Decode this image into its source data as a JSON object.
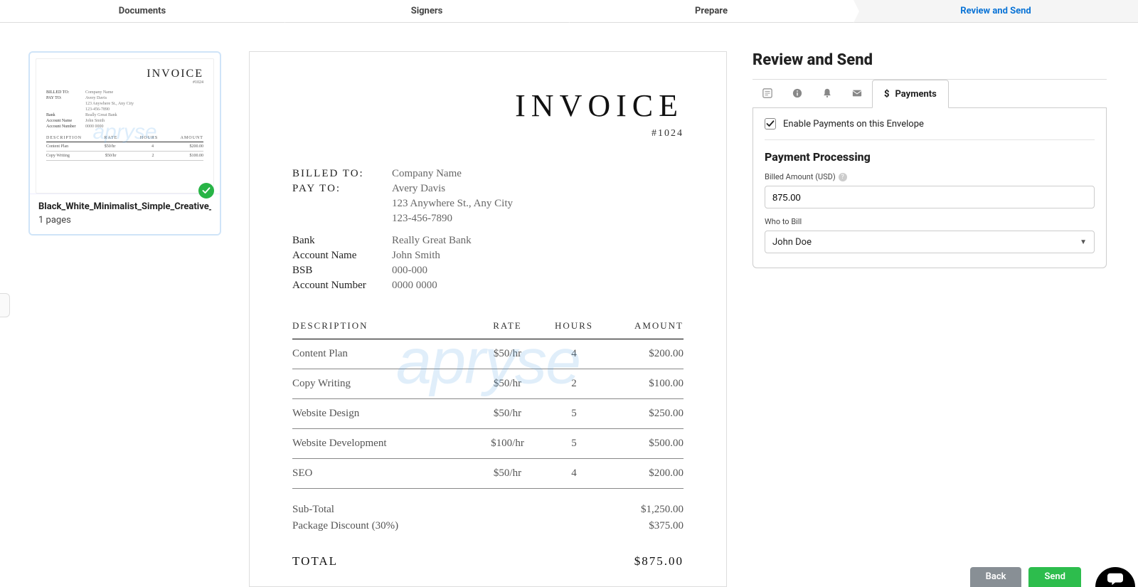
{
  "wizard": {
    "steps": [
      "Documents",
      "Signers",
      "Prepare",
      "Review and Send"
    ],
    "activeIndex": 3
  },
  "thumbnail": {
    "filename": "Black_White_Minimalist_Simple_Creative_",
    "pages": "1 pages"
  },
  "watermark": "apryse",
  "invoice": {
    "title": "INVOICE",
    "number": "#1024",
    "billedToLabel": "BILLED TO:",
    "billedTo": "Company Name",
    "payToLabel": "PAY TO:",
    "payToName": "Avery Davis",
    "payToAddr": "123 Anywhere St., Any City",
    "payToPhone": "123-456-7890",
    "bankLabel": "Bank",
    "bank": "Really Great Bank",
    "acctNameLabel": "Account Name",
    "acctName": "John Smith",
    "bsbLabel": "BSB",
    "bsb": "000-000",
    "acctNumLabel": "Account Number",
    "acctNum": "0000 0000",
    "cols": {
      "desc": "DESCRIPTION",
      "rate": "RATE",
      "hours": "HOURS",
      "amount": "AMOUNT"
    },
    "lines": [
      {
        "desc": "Content Plan",
        "rate": "$50/hr",
        "hours": "4",
        "amount": "$200.00"
      },
      {
        "desc": "Copy Writing",
        "rate": "$50/hr",
        "hours": "2",
        "amount": "$100.00"
      },
      {
        "desc": "Website Design",
        "rate": "$50/hr",
        "hours": "5",
        "amount": "$250.00"
      },
      {
        "desc": "Website Development",
        "rate": "$100/hr",
        "hours": "5",
        "amount": "$500.00"
      },
      {
        "desc": "SEO",
        "rate": "$50/hr",
        "hours": "4",
        "amount": "$200.00"
      }
    ],
    "subLabel": "Sub-Total",
    "subVal": "$1,250.00",
    "discountLabel": "Package Discount (30%)",
    "discountVal": "$375.00",
    "totalLabel": "TOTAL",
    "totalVal": "$875.00"
  },
  "panel": {
    "title": "Review and Send",
    "paymentsTab": "Payments",
    "enableLabel": "Enable Payments on this Envelope",
    "ppTitle": "Payment Processing",
    "billedAmountLabel": "Billed Amount (USD)",
    "billedAmountValue": "875.00",
    "whoLabel": "Who to Bill",
    "whoValue": "John Doe"
  },
  "buttons": {
    "back": "Back",
    "send": "Send"
  }
}
